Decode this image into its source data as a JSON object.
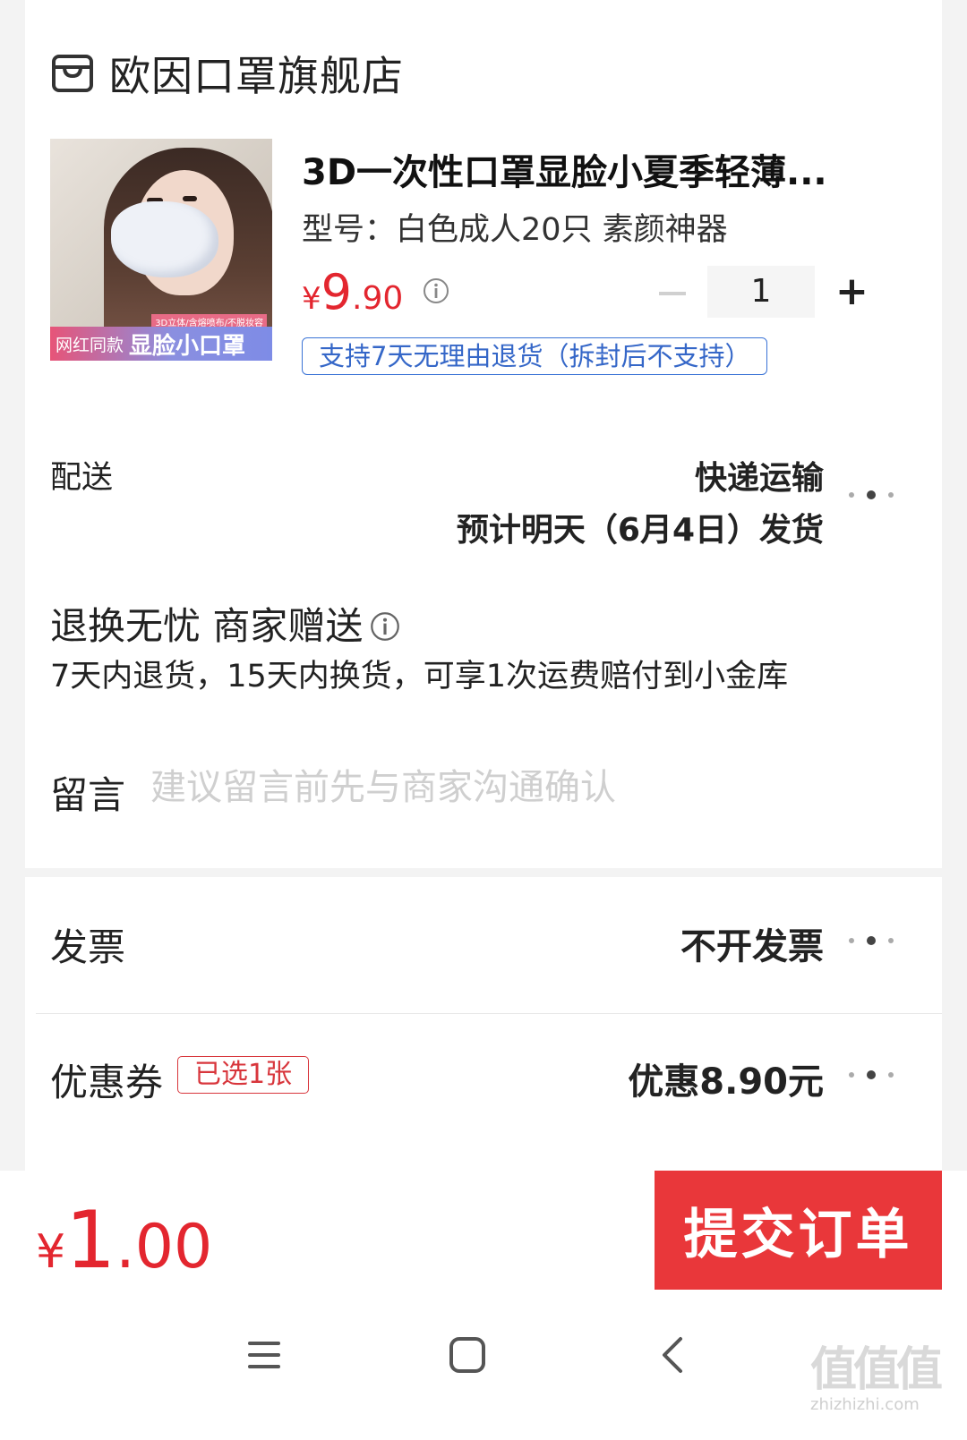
{
  "shop": {
    "name": "欧因口罩旗舰店",
    "icon": "shop-icon"
  },
  "product": {
    "title": "3D一次性口罩显脸小夏季轻薄...",
    "spec": "型号：白色成人20只 素颜神器",
    "price_currency": "¥",
    "price_int": "9",
    "price_dec": ".90",
    "quantity": "1",
    "minus_label": "−",
    "plus_label": "+",
    "policy": "支持7天无理由退货（拆封后不支持）",
    "thumb_banner_sub": "3D立体/含熔喷布/不脱妆容",
    "thumb_banner_tag": "网红同款",
    "thumb_banner_main": "显脸小口罩"
  },
  "delivery": {
    "label": "配送",
    "method": "快递运输",
    "eta": "预计明天（6月4日）发货"
  },
  "guarantee": {
    "title": "退换无忧 商家赠送",
    "desc": "7天内退货，15天内换货，可享1次运费赔付到小金库"
  },
  "note": {
    "label": "留言",
    "placeholder": "建议留言前先与商家沟通确认"
  },
  "invoice": {
    "label": "发票",
    "value": "不开发票"
  },
  "coupon": {
    "label": "优惠券",
    "badge": "已选1张",
    "value": "优惠8.90元"
  },
  "footer": {
    "total_currency": "¥",
    "total_int": "1",
    "total_dec": ".00",
    "submit_label": "提交订单"
  },
  "watermark": {
    "logo": "值值值",
    "url": "zhizhizhi.com"
  },
  "colors": {
    "accent": "#e9373a",
    "price": "#e3262f",
    "link": "#3567c8"
  }
}
